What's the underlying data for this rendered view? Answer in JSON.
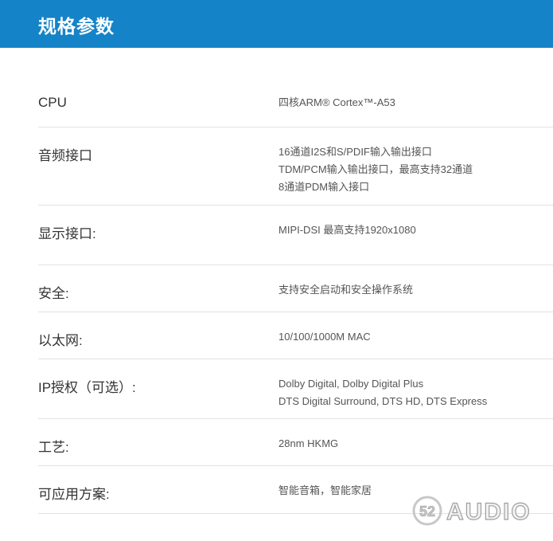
{
  "header": {
    "title": "规格参数"
  },
  "specs": [
    {
      "label": "CPU",
      "values": [
        "四核ARM® Cortex™-A53"
      ]
    },
    {
      "label": "音频接口",
      "values": [
        "16通道I2S和S/PDIF输入输出接口",
        "TDM/PCM输入输出接口，最高支持32通道",
        "8通道PDM输入接口"
      ]
    },
    {
      "label": "显示接口:",
      "values": [
        "MIPI-DSI 最高支持1920x1080"
      ]
    },
    {
      "label": "安全:",
      "values": [
        "支持安全启动和安全操作系统"
      ]
    },
    {
      "label": "以太网:",
      "values": [
        "10/100/1000M MAC"
      ]
    },
    {
      "label": "IP授权（可选）:",
      "values": [
        "Dolby Digital, Dolby Digital Plus",
        "DTS Digital Surround, DTS HD, DTS Express"
      ]
    },
    {
      "label": "工艺:",
      "values": [
        "28nm HKMG"
      ]
    },
    {
      "label": "可应用方案:",
      "values": [
        "智能音箱，智能家居"
      ]
    }
  ],
  "watermark": {
    "text": "52AUDIO"
  }
}
